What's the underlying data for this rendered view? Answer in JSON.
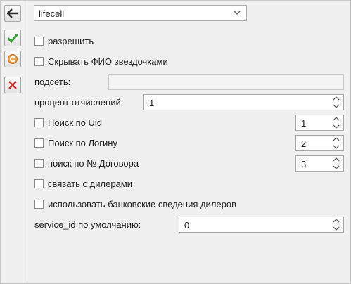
{
  "toolbar": {
    "icons": [
      "arrow-left-icon",
      "checkmark-icon",
      "refresh-icon",
      "close-icon"
    ],
    "colors": {
      "check": "#2e9e2e",
      "refresh": "#e07a1f",
      "close": "#d83030"
    }
  },
  "provider": {
    "selected": "lifecell"
  },
  "form": {
    "allow_label": "разрешить",
    "hide_fio_label": "Скрывать ФИО звездочками",
    "subnet_label": "подсеть:",
    "subnet_value": "",
    "percent_label": "процент отчислений:",
    "percent_value": "1",
    "search_uid_label": "Поиск по Uid",
    "search_uid_value": "1",
    "search_login_label": "Поиск по Логину",
    "search_login_value": "2",
    "search_contract_label": "поиск по № Договора",
    "search_contract_value": "3",
    "link_dealers_label": "связать с дилерами",
    "bank_info_label": "использовать банковские сведения дилеров",
    "service_id_label": "service_id по умолчанию:",
    "service_id_value": "0"
  }
}
